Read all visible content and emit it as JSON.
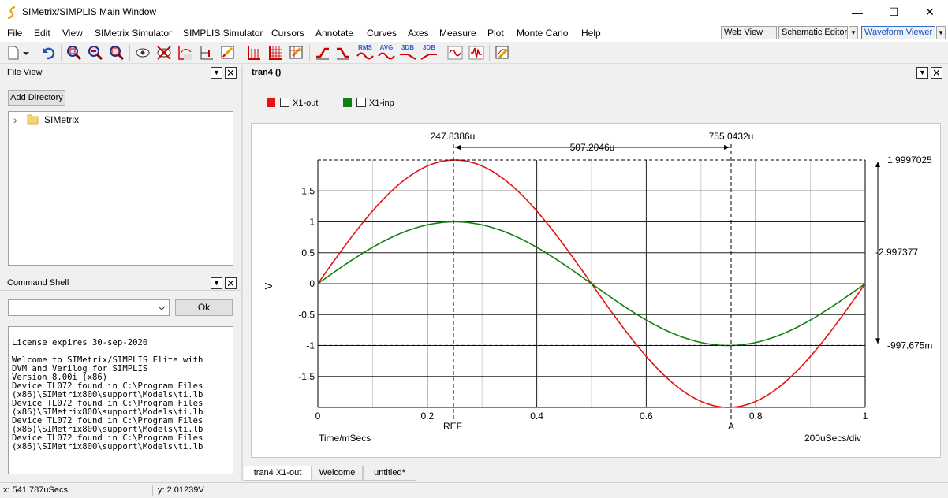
{
  "window": {
    "title": "SIMetrix/SIMPLIS Main Window",
    "minimize_glyph": "—",
    "maximize_glyph": "☐",
    "close_glyph": "✕"
  },
  "menu": [
    {
      "label": "File"
    },
    {
      "label": "Edit"
    },
    {
      "label": "View"
    },
    {
      "label": "SIMetrix Simulator"
    },
    {
      "label": "SIMPLIS Simulator"
    },
    {
      "label": "Cursors"
    },
    {
      "label": "Annotate"
    },
    {
      "label": "Curves"
    },
    {
      "label": "Axes"
    },
    {
      "label": "Measure"
    },
    {
      "label": "Plot"
    },
    {
      "label": "Monte Carlo"
    },
    {
      "label": "Help"
    }
  ],
  "views": {
    "web_view": "Web View",
    "schematic_editor": "Schematic Editor",
    "waveform_viewer": "Waveform Viewer",
    "drop_glyph": "▼"
  },
  "toolbar": {
    "rms": "RMS",
    "avg": "AVG",
    "db1": "3DB",
    "db2": "3DB"
  },
  "file_view": {
    "title": "File View",
    "add_directory": "Add Directory",
    "tree_item": "SIMetrix",
    "expand_glyph": "›"
  },
  "command_shell": {
    "title": "Command Shell",
    "command_value": "",
    "ok_label": "Ok",
    "output": "\nLicense expires 30-sep-2020\n\nWelcome to SIMetrix/SIMPLIS Elite with\nDVM and Verilog for SIMPLIS\nVersion 8.00i (x86)\nDevice TL072 found in C:\\Program Files\n(x86)\\SIMetrix800\\support\\Models\\ti.lb\nDevice TL072 found in C:\\Program Files\n(x86)\\SIMetrix800\\support\\Models\\ti.lb\nDevice TL072 found in C:\\Program Files\n(x86)\\SIMetrix800\\support\\Models\\ti.lb\nDevice TL072 found in C:\\Program Files\n(x86)\\SIMetrix800\\support\\Models\\ti.lb"
  },
  "graph_panel": {
    "title": "tran4 ()",
    "min_glyph": "▼",
    "close_glyph": "✕"
  },
  "legend": [
    {
      "label": "X1-out",
      "color": "#e81010"
    },
    {
      "label": "X1-inp",
      "color": "#108010"
    }
  ],
  "cursors": {
    "ref_time": "247.8386u",
    "a_time": "755.0432u",
    "delta_time": "507.2046u",
    "ref_label": "REF",
    "a_label": "A",
    "ref_value": "1.9997025",
    "delta_value": "-2.997377",
    "a_value": "-997.675m"
  },
  "tabs": [
    {
      "label": "tran4 X1-out"
    },
    {
      "label": "Welcome"
    },
    {
      "label": "untitled*"
    }
  ],
  "status": {
    "x": "x: 541.787uSecs",
    "y": "y: 2.01239V"
  },
  "chart_data": {
    "type": "line",
    "title": "",
    "xlabel": "Time/mSecs",
    "ylabel": "V",
    "x_scale_label": "200uSecs/div",
    "xlim": [
      0,
      1
    ],
    "ylim": [
      -2,
      2
    ],
    "x_ticks": [
      0,
      0.2,
      0.4,
      0.6,
      0.8,
      1
    ],
    "x_tick_labels": [
      "0",
      "0.2",
      "0.4",
      "0.6",
      "0.8",
      "1"
    ],
    "y_ticks": [
      1.5,
      1,
      0.5,
      0,
      -0.5,
      -1,
      -1.5
    ],
    "y_tick_labels": [
      "1.5",
      "1",
      "0.5",
      "0",
      "-0.5",
      "-1",
      "-1.5"
    ],
    "grid": true,
    "series": [
      {
        "name": "X1-out",
        "color": "#e81010",
        "x": [
          0,
          0.05,
          0.1,
          0.15,
          0.2,
          0.25,
          0.3,
          0.35,
          0.4,
          0.45,
          0.5,
          0.55,
          0.6,
          0.65,
          0.7,
          0.75,
          0.8,
          0.85,
          0.9,
          0.95,
          1
        ],
        "y": [
          0,
          0.62,
          1.18,
          1.62,
          1.9,
          2.0,
          1.9,
          1.62,
          1.18,
          0.62,
          0,
          -0.62,
          -1.18,
          -1.62,
          -1.9,
          -2.0,
          -1.9,
          -1.62,
          -1.18,
          -0.62,
          0
        ]
      },
      {
        "name": "X1-inp",
        "color": "#108010",
        "x": [
          0,
          0.05,
          0.1,
          0.15,
          0.2,
          0.25,
          0.3,
          0.35,
          0.4,
          0.45,
          0.5,
          0.55,
          0.6,
          0.65,
          0.7,
          0.75,
          0.8,
          0.85,
          0.9,
          0.95,
          1
        ],
        "y": [
          0,
          0.31,
          0.59,
          0.81,
          0.95,
          1.0,
          0.95,
          0.81,
          0.59,
          0.31,
          0,
          -0.31,
          -0.59,
          -0.81,
          -0.95,
          -1.0,
          -0.95,
          -0.81,
          -0.59,
          -0.31,
          0
        ]
      }
    ]
  }
}
